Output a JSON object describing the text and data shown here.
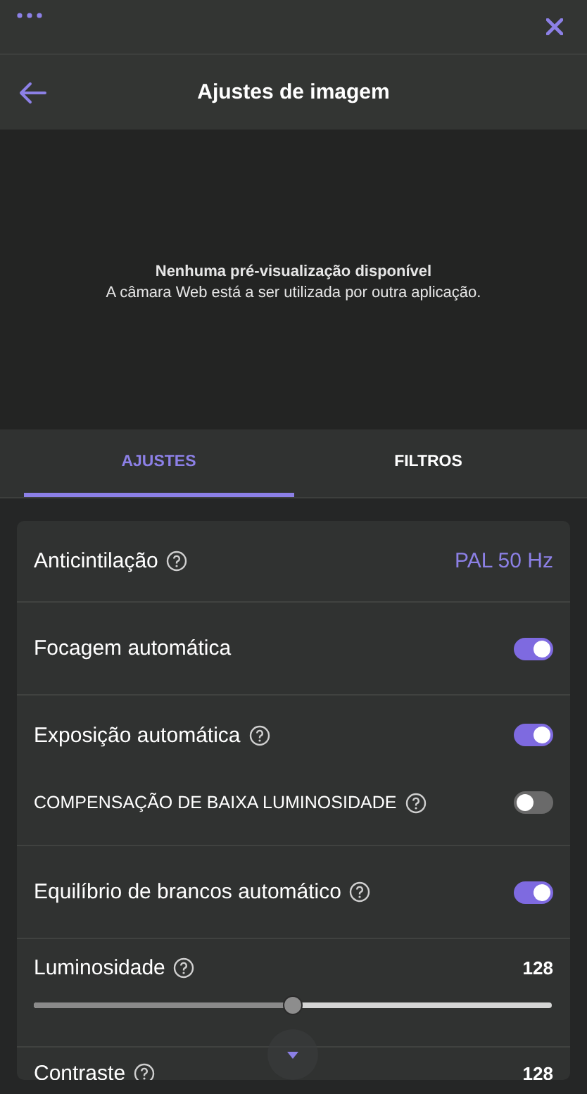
{
  "window": {
    "title": "Ajustes de imagem"
  },
  "preview": {
    "title": "Nenhuma pré-visualização disponível",
    "message": "A câmara Web está a ser utilizada por outra aplicação."
  },
  "tabs": [
    {
      "label": "AJUSTES",
      "selected": true
    },
    {
      "label": "FILTROS",
      "selected": false
    }
  ],
  "sections": [
    {
      "items": [
        {
          "kind": "select",
          "label": "Anticintilação",
          "help": true,
          "value": "PAL 50 Hz"
        }
      ]
    },
    {
      "items": [
        {
          "kind": "toggle",
          "label": "Focagem automática",
          "on": true
        }
      ]
    },
    {
      "items": [
        {
          "kind": "toggle",
          "label": "Exposição automática",
          "help": true,
          "on": true
        },
        {
          "kind": "subtoggle",
          "label": "COMPENSAÇÃO DE BAIXA LUMINOSIDADE",
          "help": true,
          "on": false
        }
      ]
    },
    {
      "items": [
        {
          "kind": "toggle",
          "label": "Equilíbrio de brancos automático",
          "help": true,
          "on": true
        }
      ]
    },
    {
      "items": [
        {
          "kind": "slider",
          "label": "Luminosidade",
          "help": true,
          "reading": "128",
          "level": 0.5
        }
      ]
    },
    {
      "items": [
        {
          "kind": "reading",
          "label": "Contraste",
          "help": true,
          "reading": "128"
        }
      ]
    }
  ]
}
